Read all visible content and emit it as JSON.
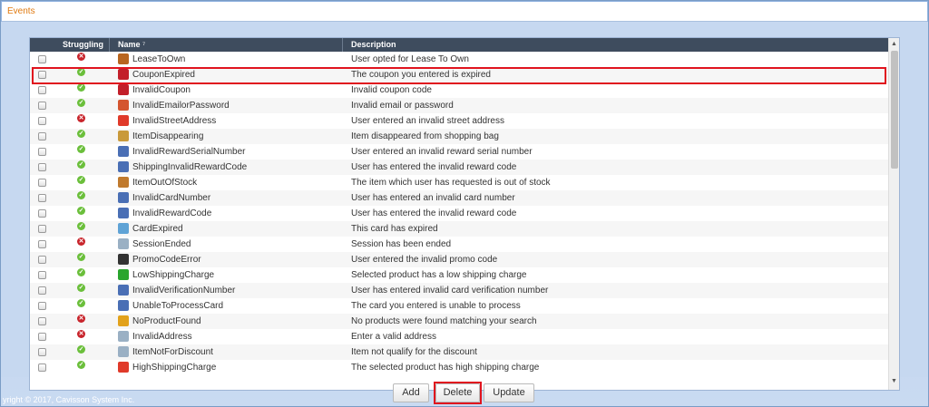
{
  "window": {
    "title": "Events"
  },
  "table": {
    "columns": {
      "struggling": "Struggling",
      "name": "Name",
      "description": "Description"
    },
    "rows": [
      {
        "status": "bad",
        "icon_name": "lease-icon",
        "icon_color": "#b8651f",
        "name": "LeaseToOwn",
        "description": "User opted for Lease To Own"
      },
      {
        "status": "ok",
        "icon_name": "coupon-tag-icon",
        "icon_color": "#c21f2a",
        "name": "CouponExpired",
        "description": "The coupon you entered is expired"
      },
      {
        "status": "ok",
        "icon_name": "coupon-tag-icon",
        "icon_color": "#c21f2a",
        "name": "InvalidCoupon",
        "description": "Invalid coupon code"
      },
      {
        "status": "ok",
        "icon_name": "password-icon",
        "icon_color": "#d4552f",
        "name": "InvalidEmailorPassword",
        "description": "Invalid email or password"
      },
      {
        "status": "bad",
        "icon_name": "plane-icon",
        "icon_color": "#e03a2a",
        "name": "InvalidStreetAddress",
        "description": "User entered an invalid street address"
      },
      {
        "status": "ok",
        "icon_name": "bag-icon",
        "icon_color": "#c99a3b",
        "name": "ItemDisappearing",
        "description": "Item disappeared from shopping bag"
      },
      {
        "status": "ok",
        "icon_name": "card-icon",
        "icon_color": "#4a6fb5",
        "name": "InvalidRewardSerialNumber",
        "description": "User entered an invalid reward serial number"
      },
      {
        "status": "ok",
        "icon_name": "card-icon",
        "icon_color": "#4a6fb5",
        "name": "ShippingInvalidRewardCode",
        "description": "User has entered the invalid reward code"
      },
      {
        "status": "ok",
        "icon_name": "box-icon",
        "icon_color": "#c07a2e",
        "name": "ItemOutOfStock",
        "description": "The item which user has requested is out of stock"
      },
      {
        "status": "ok",
        "icon_name": "card-icon",
        "icon_color": "#4a6fb5",
        "name": "InvalidCardNumber",
        "description": "User has entered an invalid card number"
      },
      {
        "status": "ok",
        "icon_name": "card-icon",
        "icon_color": "#4a6fb5",
        "name": "InvalidRewardCode",
        "description": "User has entered the invalid reward code"
      },
      {
        "status": "ok",
        "icon_name": "card-expired-icon",
        "icon_color": "#5fa3d6",
        "name": "CardExpired",
        "description": "This card has expired"
      },
      {
        "status": "bad",
        "icon_name": "session-icon",
        "icon_color": "#9ab0c4",
        "name": "SessionEnded",
        "description": "Session has been ended"
      },
      {
        "status": "ok",
        "icon_name": "promo-tag-icon",
        "icon_color": "#333333",
        "name": "PromoCodeError",
        "description": "User entered the invalid promo code"
      },
      {
        "status": "ok",
        "icon_name": "truck-icon",
        "icon_color": "#2aa52e",
        "name": "LowShippingCharge",
        "description": "Selected product has a low shipping charge"
      },
      {
        "status": "ok",
        "icon_name": "card-icon",
        "icon_color": "#4a6fb5",
        "name": "InvalidVerificationNumber",
        "description": "User has entered invalid card verification number"
      },
      {
        "status": "ok",
        "icon_name": "card-icon",
        "icon_color": "#4a6fb5",
        "name": "UnableToProcessCard",
        "description": "The card you entered is unable to process"
      },
      {
        "status": "bad",
        "icon_name": "not-found-icon",
        "icon_color": "#e2a21c",
        "name": "NoProductFound",
        "description": "No products were found matching your search"
      },
      {
        "status": "bad",
        "icon_name": "address-icon",
        "icon_color": "#9ab0c4",
        "name": "InvalidAddress",
        "description": "Enter a valid address"
      },
      {
        "status": "ok",
        "icon_name": "discount-icon",
        "icon_color": "#9ab0c4",
        "name": "ItemNotForDiscount",
        "description": "Item not qualify for the discount"
      },
      {
        "status": "ok",
        "icon_name": "plane-icon",
        "icon_color": "#e03a2a",
        "name": "HighShippingCharge",
        "description": "The selected product has high shipping charge"
      }
    ]
  },
  "buttons": {
    "add": "Add",
    "delete": "Delete",
    "update": "Update"
  },
  "footer": {
    "copyright": "yright © 2017, Cavisson System Inc."
  },
  "colors": {
    "title_accent": "#e07a10",
    "header_bg": "#3e4c5e",
    "highlight": "#e0141e"
  }
}
